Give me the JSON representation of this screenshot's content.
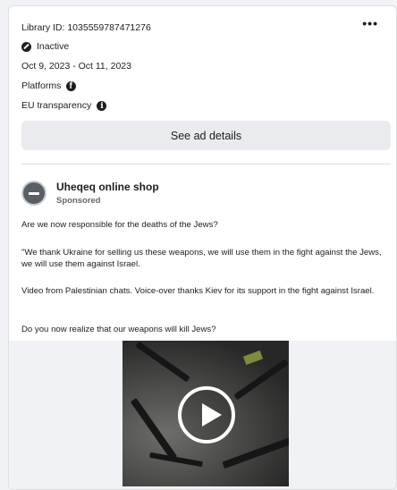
{
  "ad": {
    "library_id": "Library ID: 1035559787471276",
    "status": "Inactive",
    "date_range": "Oct 9, 2023 - Oct 11, 2023",
    "platforms_label": "Platforms",
    "eu_label": "EU transparency",
    "more_label": "•••",
    "details_button": "See ad details"
  },
  "advertiser": {
    "name": "Uheqeq online shop",
    "sponsored": "Sponsored"
  },
  "body": [
    "Are we now responsible for the deaths of the Jews?",
    "\"We thank Ukraine for selling us these weapons, we will use them in the fight against the Jews, we will use them against Israel.",
    "Video from Palestinian chats. Voice-over thanks Kiev for its support in the fight against Israel.",
    "Do you now realize that our weapons will kill Jews?"
  ],
  "icons": {
    "status": "inactive-icon",
    "platform": "facebook-icon",
    "eu": "info-icon",
    "play": "play-icon"
  }
}
